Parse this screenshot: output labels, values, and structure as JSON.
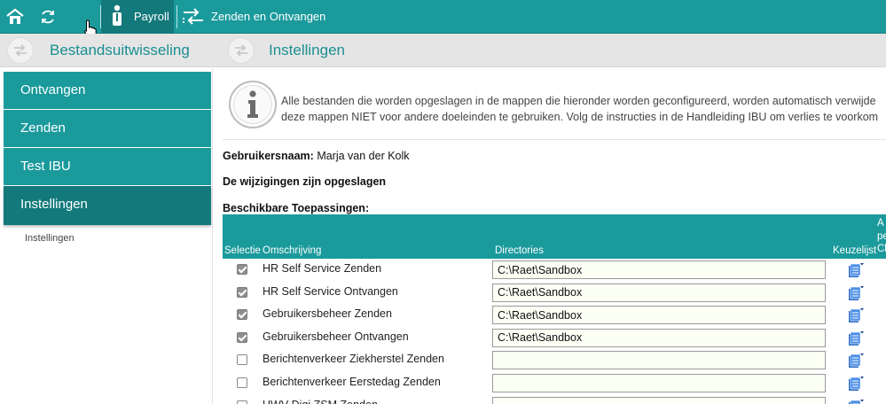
{
  "topbar": {
    "home_icon": "home-icon",
    "refresh_icon": "refresh-icon",
    "payroll_label": "Payroll",
    "zenden_label": "Zenden en Ontvangen"
  },
  "subheader": {
    "left_title": "Bestandsuitwisseling",
    "right_title": "Instellingen"
  },
  "sidebar": {
    "items": [
      {
        "label": "Ontvangen"
      },
      {
        "label": "Zenden"
      },
      {
        "label": "Test IBU"
      },
      {
        "label": "Instellingen"
      }
    ],
    "subitem": "Instellingen"
  },
  "info": {
    "line1": "Alle bestanden die worden opgeslagen in de mappen die hieronder worden geconfigureerd, worden automatisch verwijde",
    "line2": "deze mappen NIET voor andere doeleinden te gebruiken. Volg de instructies in de Handleiding IBU om verlies te voorkom"
  },
  "user": {
    "label": "Gebruikersnaam:",
    "value": "Marja van der Kolk"
  },
  "saved_message": "De wijzigingen zijn opgeslagen",
  "apps_heading": "Beschikbare Toepassingen:",
  "table": {
    "headers": {
      "selectie": "Selectie",
      "omschrijving": "Omschrijving",
      "directories": "Directories",
      "keuzelijst": "Keuzelijst",
      "extra_line1": "A",
      "extra_line2": "pe",
      "extra_line3": "Cl"
    },
    "rows": [
      {
        "checked": true,
        "desc": "HR Self Service Zenden",
        "dir": "C:\\Raet\\Sandbox"
      },
      {
        "checked": true,
        "desc": "HR Self Service Ontvangen",
        "dir": "C:\\Raet\\Sandbox"
      },
      {
        "checked": true,
        "desc": "Gebruikersbeheer Zenden",
        "dir": "C:\\Raet\\Sandbox"
      },
      {
        "checked": true,
        "desc": "Gebruikersbeheer Ontvangen",
        "dir": "C:\\Raet\\Sandbox"
      },
      {
        "checked": false,
        "desc": "Berichtenverkeer Ziekherstel Zenden",
        "dir": ""
      },
      {
        "checked": false,
        "desc": "Berichtenverkeer Eerstedag Zenden",
        "dir": ""
      },
      {
        "checked": false,
        "desc": "UWV Digi ZSM Zenden",
        "dir": ""
      }
    ]
  },
  "colors": {
    "teal": "#1b9a9c",
    "teal_dark": "#13797b",
    "input_bg": "#fbfff4"
  }
}
